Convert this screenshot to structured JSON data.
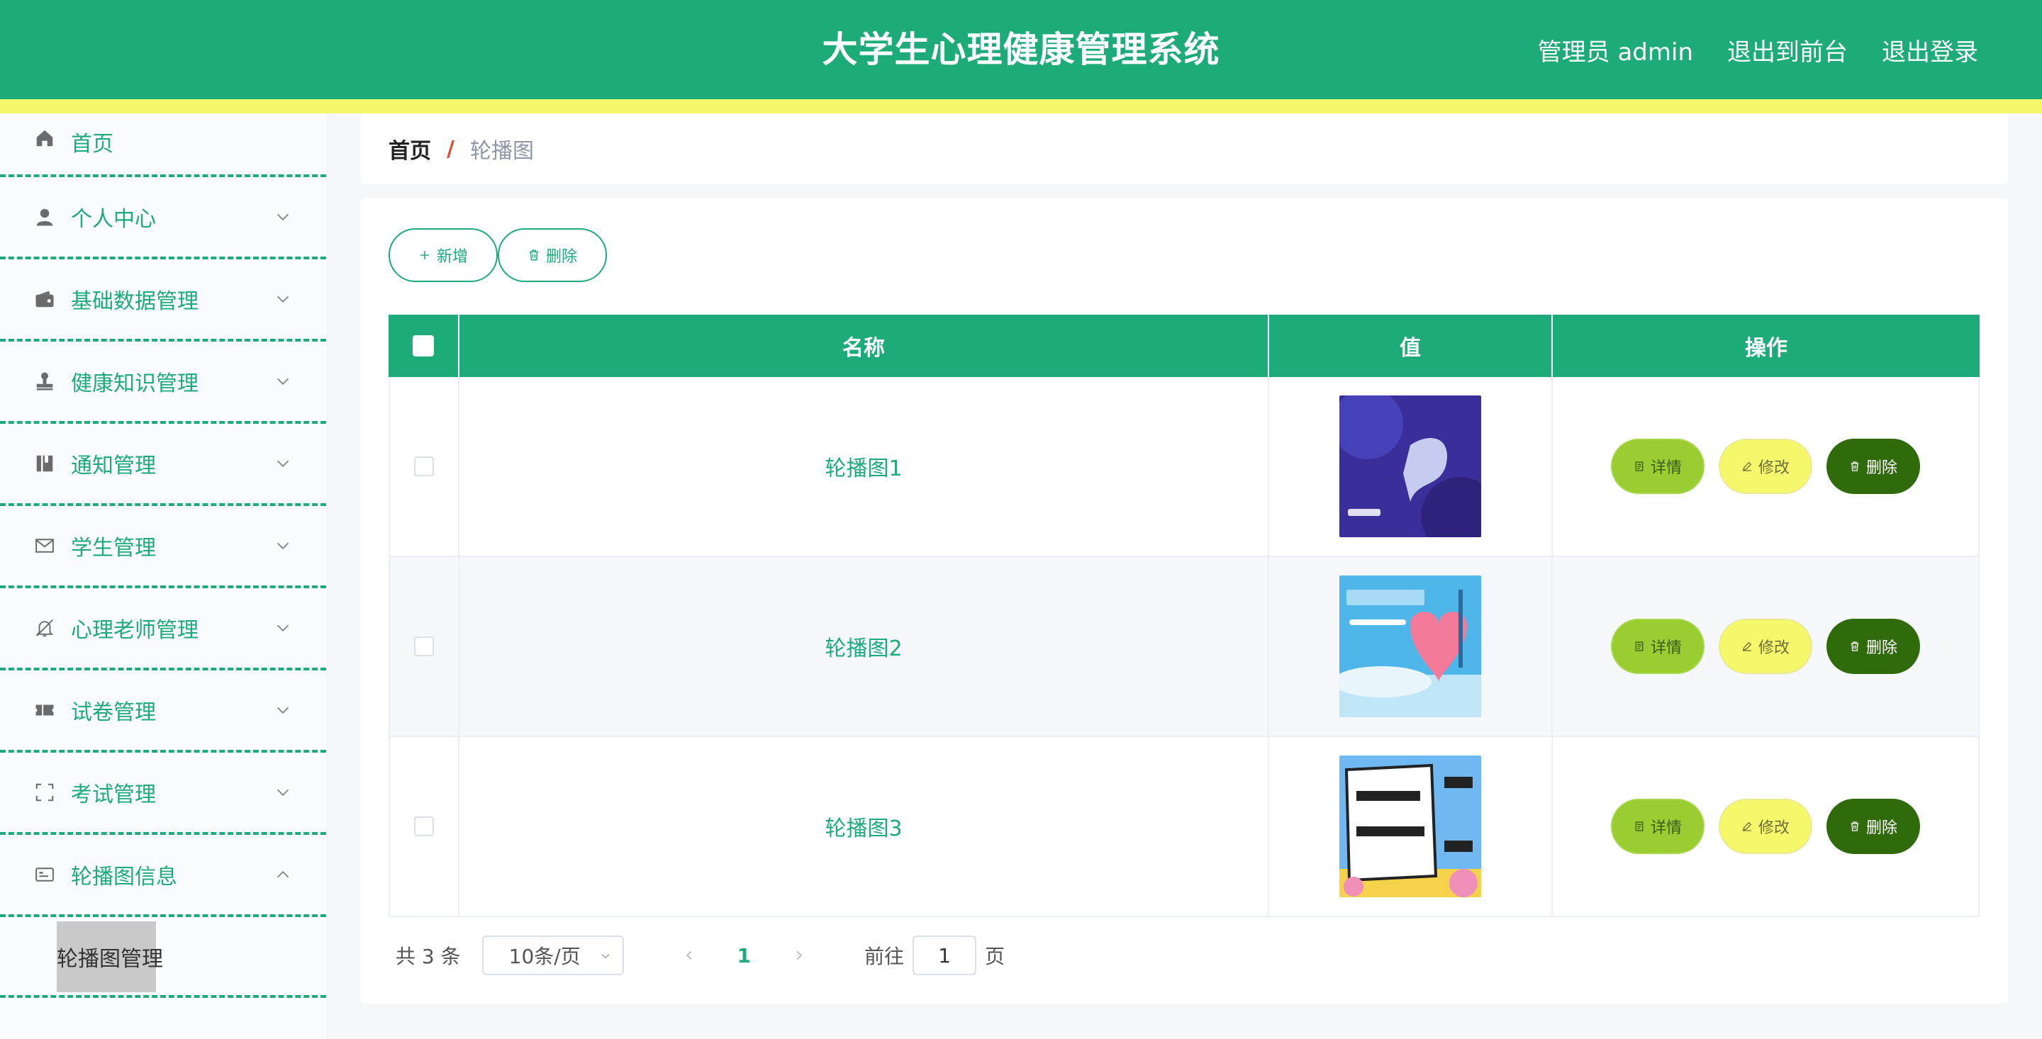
{
  "header": {
    "title": "大学生心理健康管理系统",
    "user_label": "管理员 admin",
    "front_link": "退出到前台",
    "logout_link": "退出登录"
  },
  "sidebar": {
    "items": [
      {
        "label": "首页",
        "icon": "home-icon"
      },
      {
        "label": "个人中心",
        "icon": "user-icon"
      },
      {
        "label": "基础数据管理",
        "icon": "wallet-icon"
      },
      {
        "label": "健康知识管理",
        "icon": "stamp-icon"
      },
      {
        "label": "通知管理",
        "icon": "notebook-icon"
      },
      {
        "label": "学生管理",
        "icon": "mail-icon"
      },
      {
        "label": "心理老师管理",
        "icon": "bell-off-icon"
      },
      {
        "label": "试卷管理",
        "icon": "ticket-icon"
      },
      {
        "label": "考试管理",
        "icon": "full-screen-icon"
      },
      {
        "label": "轮播图信息",
        "icon": "card-icon"
      }
    ],
    "sub_active": "轮播图管理"
  },
  "breadcrumb": {
    "home": "首页",
    "separator": "/",
    "current": "轮播图"
  },
  "toolbar": {
    "add_label": "新增",
    "delete_label": "删除"
  },
  "table": {
    "headers": [
      "名称",
      "值",
      "操作"
    ],
    "rows": [
      {
        "name": "轮播图1",
        "image": "banner-1-thumbnail"
      },
      {
        "name": "轮播图2",
        "image": "banner-2-thumbnail"
      },
      {
        "name": "轮播图3",
        "image": "banner-3-thumbnail"
      }
    ],
    "actions": {
      "detail": "详情",
      "edit": "修改",
      "delete": "删除"
    }
  },
  "pagination": {
    "total": "共 3 条",
    "page_size": "10条/页",
    "current_page": "1",
    "goto_label": "前往",
    "goto_value": "1",
    "page_suffix": "页"
  },
  "colors": {
    "primary": "#1dab7a",
    "accent_yellow": "#f4f86a",
    "detail_green": "#9acd32",
    "delete_dark": "#2f6b0a"
  }
}
